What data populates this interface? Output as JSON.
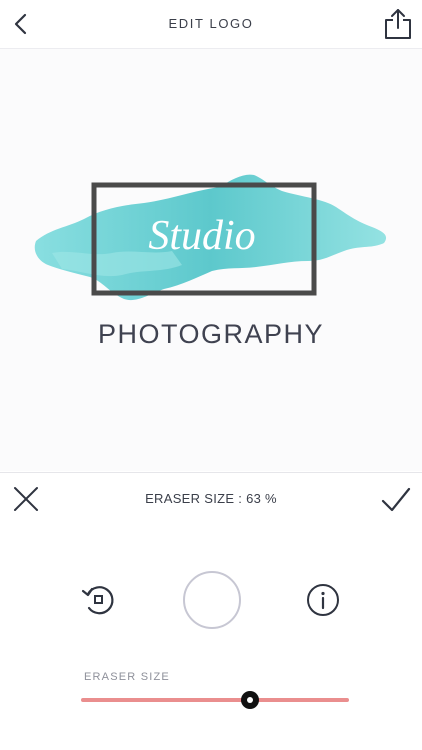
{
  "header": {
    "title": "EDIT LOGO",
    "back_icon": "chevron-left-icon",
    "share_icon": "share-icon"
  },
  "logo": {
    "script_text": "Studio",
    "subtitle": "PHOTOGRAPHY",
    "accent_color": "#5cc9cb",
    "frame_color": "#4a4a4a"
  },
  "toolbar": {
    "label": "ERASER SIZE : 63 %",
    "cancel_icon": "close-icon",
    "confirm_icon": "checkmark-icon"
  },
  "controls": {
    "undo_icon": "undo-icon",
    "info_icon": "info-icon",
    "slider_label": "ERASER SIZE",
    "slider_value": 0.63,
    "slider_color": "#ea8e8e"
  }
}
